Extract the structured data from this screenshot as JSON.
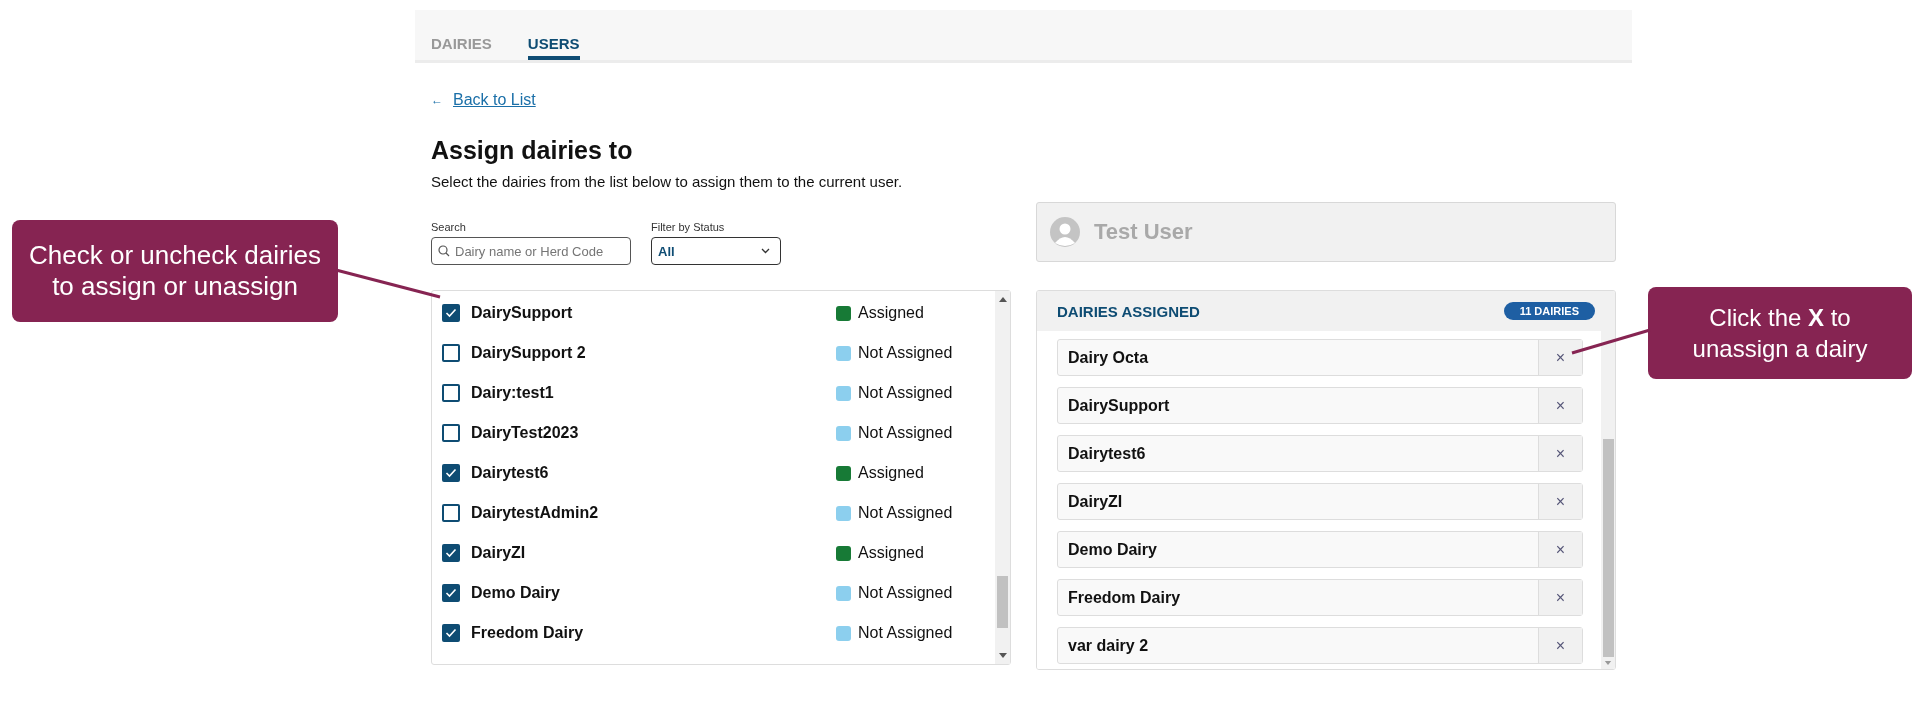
{
  "tabs": [
    {
      "label": "DAIRIES",
      "selected": false
    },
    {
      "label": "USERS",
      "selected": true
    }
  ],
  "back_link": {
    "icon": "←",
    "label": "Back to List"
  },
  "title": "Assign dairies to",
  "subtitle": "Select the dairies from the list below to assign them to the current user.",
  "search": {
    "label": "Search",
    "placeholder": "Dairy name or Herd Code"
  },
  "filter": {
    "label": "Filter by Status",
    "value": "All"
  },
  "dairies": [
    {
      "name": "DairySupport",
      "checked": true,
      "status": "Assigned",
      "color": "#177a36"
    },
    {
      "name": "DairySupport 2",
      "checked": false,
      "status": "Not Assigned",
      "color": "#8ccfee"
    },
    {
      "name": "Dairy:test1",
      "checked": false,
      "status": "Not Assigned",
      "color": "#8ccfee"
    },
    {
      "name": "DairyTest2023",
      "checked": false,
      "status": "Not Assigned",
      "color": "#8ccfee"
    },
    {
      "name": "Dairytest6",
      "checked": true,
      "status": "Assigned",
      "color": "#177a36"
    },
    {
      "name": "DairytestAdmin2",
      "checked": false,
      "status": "Not Assigned",
      "color": "#8ccfee"
    },
    {
      "name": "DairyZI",
      "checked": true,
      "status": "Assigned",
      "color": "#177a36"
    },
    {
      "name": "Demo Dairy",
      "checked": true,
      "status": "Not Assigned",
      "color": "#8ccfee"
    },
    {
      "name": "Freedom Dairy",
      "checked": true,
      "status": "Not Assigned",
      "color": "#8ccfee"
    }
  ],
  "user": {
    "name": "Test User"
  },
  "assigned": {
    "title": "DAIRIES ASSIGNED",
    "count": "11 DAIRIES",
    "items": [
      {
        "name": "Dairy Octa",
        "remove": "×"
      },
      {
        "name": "DairySupport",
        "remove": "×"
      },
      {
        "name": "Dairytest6",
        "remove": "×"
      },
      {
        "name": "DairyZI",
        "remove": "×"
      },
      {
        "name": "Demo Dairy",
        "remove": "×"
      },
      {
        "name": "Freedom Dairy",
        "remove": "×"
      },
      {
        "name": "var dairy 2",
        "remove": "×"
      }
    ]
  },
  "callouts": [
    {
      "text": "Check or uncheck dairies to assign or unassign"
    },
    {
      "text": "Click the **X** to unassign a dairy"
    }
  ]
}
